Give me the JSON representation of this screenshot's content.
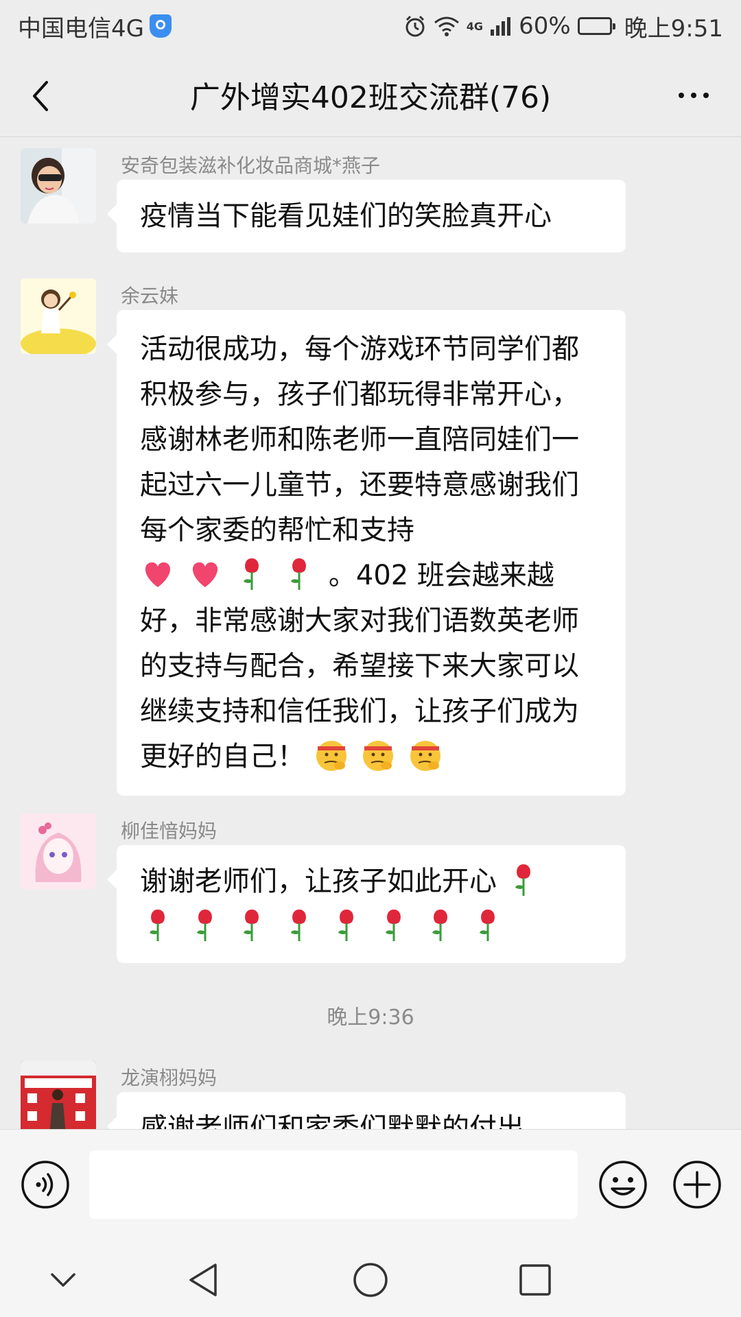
{
  "status_bar": {
    "carrier": "中国电信4G",
    "network_label": "4G",
    "battery_text": "60%",
    "battery_level": 0.6,
    "time": "晚上9:51"
  },
  "nav": {
    "title": "广外增实402班交流群(76)"
  },
  "messages": [
    {
      "sender": "安奇包装滋补化妆品商城*燕子",
      "text": "疫情当下能看见娃们的笑脸真开心"
    },
    {
      "sender": "余云妹",
      "text_part1": "活动很成功，每个游戏环节同学们都积极参与，孩子们都玩得非常开心，感谢林老师和陈老师一直陪同娃们一起过六一儿童节，还要特意感谢我们每个家委的帮忙和支持",
      "text_part2": "。402 班会越来越好，非常感谢大家对我们语数英老师的支持与配合，希望接下来大家可以继续支持和信任我们，让孩子们成为更好的自己！"
    },
    {
      "sender": "柳佳愔妈妈",
      "text": "谢谢老师们，让孩子如此开心"
    },
    {
      "sender": "龙演栩妈妈",
      "text": "感谢老师们和家委们默默的付出"
    }
  ],
  "timestamp": "晚上9:36",
  "input": {
    "placeholder": ""
  },
  "icons": {
    "back": "chevron-left-icon",
    "more": "more-dots-icon",
    "voice": "voice-icon",
    "emoji": "emoji-icon",
    "plus": "plus-icon",
    "heart": "heart-icon",
    "rose": "rose-icon",
    "salute_face": "saluting-face-icon"
  },
  "colors": {
    "background": "#ededed",
    "bubble": "#ffffff",
    "muted_text": "#8a8a8a"
  }
}
